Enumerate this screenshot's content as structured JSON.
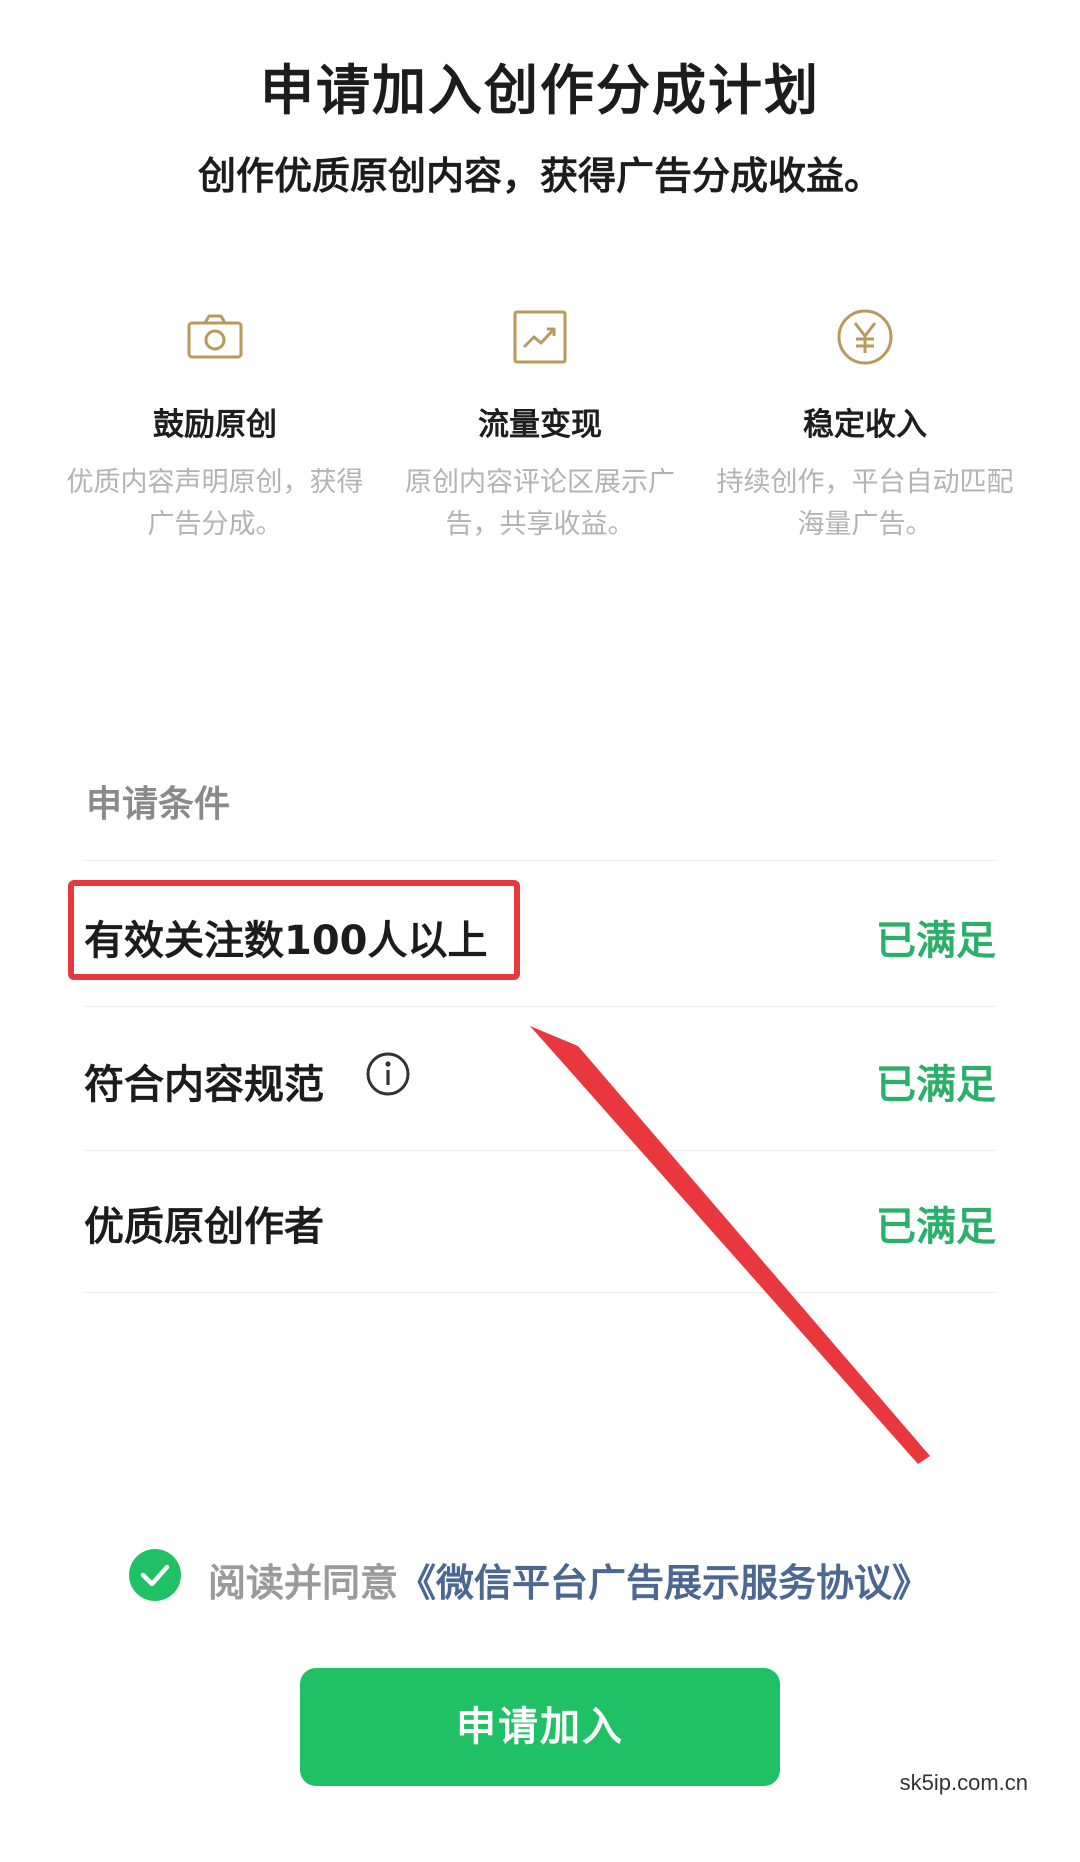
{
  "header": {
    "title": "申请加入创作分成计划",
    "subtitle": "创作优质原创内容，获得广告分成收益。"
  },
  "features": [
    {
      "icon": "camera-icon",
      "title": "鼓励原创",
      "desc": "优质内容声明原创，获得广告分成。"
    },
    {
      "icon": "trend-chart-icon",
      "title": "流量变现",
      "desc": "原创内容评论区展示广告，共享收益。"
    },
    {
      "icon": "yen-coin-icon",
      "title": "稳定收入",
      "desc": "持续创作，平台自动匹配海量广告。"
    }
  ],
  "conditions": {
    "header": "申请条件",
    "items": [
      {
        "label": "有效关注数100人以上",
        "status": "已满足",
        "highlighted": true
      },
      {
        "label": "符合内容规范",
        "status": "已满足",
        "has_info_icon": true
      },
      {
        "label": "优质原创作者",
        "status": "已满足"
      }
    ]
  },
  "agreement": {
    "checked": true,
    "prefix": "阅读并同意",
    "link": "《微信平台广告展示服务协议》"
  },
  "join_button": "申请加入",
  "watermark": "sk5ip.com.cn",
  "colors": {
    "accent_green": "#20c064",
    "status_green": "#2ab06a",
    "icon_gold": "#b89a5c",
    "highlight_red": "#e8383d",
    "link_blue": "#4a6891"
  }
}
